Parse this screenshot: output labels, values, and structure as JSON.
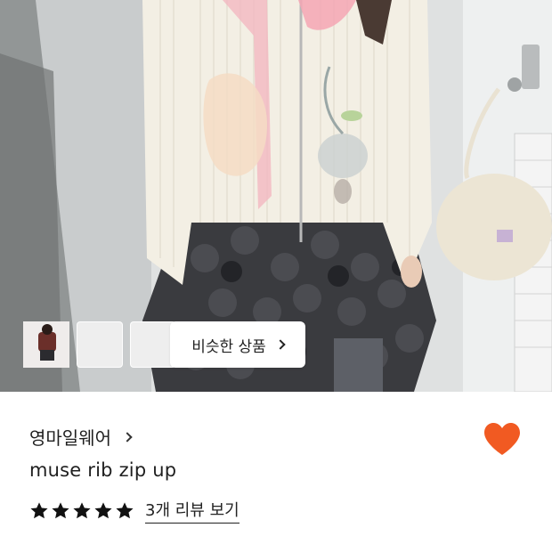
{
  "hero": {
    "similar_button_label": "비슷한 상품",
    "thumbnails": [
      {
        "icon": "thumbnail-dark-outfit"
      },
      {
        "icon": "thumbnail-light-outfit"
      },
      {
        "icon": "thumbnail-brown-outfit"
      }
    ]
  },
  "product": {
    "brand": "영마일웨어",
    "name": "muse rib zip up",
    "rating_stars": 5,
    "review_link": "3개 리뷰 보기",
    "favorite": true
  },
  "colors": {
    "heart": "#f15a22",
    "stars": "#111111"
  }
}
